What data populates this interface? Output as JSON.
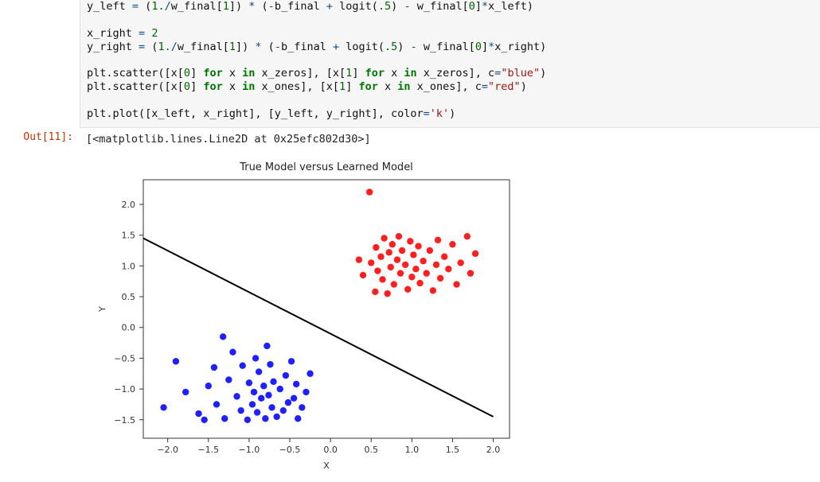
{
  "cell": {
    "out_prompt": "Out[11]:",
    "out_text": "[<matplotlib.lines.Line2D at 0x25efc802d30>]",
    "code_tokens": [
      [
        "y_left ",
        ""
      ],
      [
        "=",
        "op"
      ],
      [
        " (",
        ""
      ],
      [
        "1.",
        "num"
      ],
      [
        "/",
        "op"
      ],
      [
        "w_final[",
        ""
      ],
      [
        "1",
        "num"
      ],
      [
        "]) ",
        ""
      ],
      [
        "*",
        "op"
      ],
      [
        " (",
        ""
      ],
      [
        "-",
        "op"
      ],
      [
        "b_final ",
        ""
      ],
      [
        "+",
        "op"
      ],
      [
        " logit(",
        ""
      ],
      [
        ".5",
        "num"
      ],
      [
        ") ",
        ""
      ],
      [
        "-",
        "op"
      ],
      [
        " w_final[",
        ""
      ],
      [
        "0",
        "num"
      ],
      [
        "]",
        ""
      ],
      [
        "*",
        "op"
      ],
      [
        "x_left)\n",
        ""
      ],
      [
        "\n",
        ""
      ],
      [
        "x_right ",
        ""
      ],
      [
        "=",
        "op"
      ],
      [
        " ",
        ""
      ],
      [
        "2",
        "num"
      ],
      [
        "\n",
        ""
      ],
      [
        "y_right ",
        ""
      ],
      [
        "=",
        "op"
      ],
      [
        " (",
        ""
      ],
      [
        "1.",
        "num"
      ],
      [
        "/",
        "op"
      ],
      [
        "w_final[",
        ""
      ],
      [
        "1",
        "num"
      ],
      [
        "]) ",
        ""
      ],
      [
        "*",
        "op"
      ],
      [
        " (",
        ""
      ],
      [
        "-",
        "op"
      ],
      [
        "b_final ",
        ""
      ],
      [
        "+",
        "op"
      ],
      [
        " logit(",
        ""
      ],
      [
        ".5",
        "num"
      ],
      [
        ") ",
        ""
      ],
      [
        "-",
        "op"
      ],
      [
        " w_final[",
        ""
      ],
      [
        "0",
        "num"
      ],
      [
        "]",
        ""
      ],
      [
        "*",
        "op"
      ],
      [
        "x_right)\n",
        ""
      ],
      [
        "\n",
        ""
      ],
      [
        "plt.scatter([x[",
        ""
      ],
      [
        "0",
        "num"
      ],
      [
        "] ",
        ""
      ],
      [
        "for",
        "kw"
      ],
      [
        " x ",
        ""
      ],
      [
        "in",
        "kw"
      ],
      [
        " x_zeros], [x[",
        ""
      ],
      [
        "1",
        "num"
      ],
      [
        "] ",
        ""
      ],
      [
        "for",
        "kw"
      ],
      [
        " x ",
        ""
      ],
      [
        "in",
        "kw"
      ],
      [
        " x_zeros], c",
        ""
      ],
      [
        "=",
        "op"
      ],
      [
        "\"blue\"",
        "str"
      ],
      [
        ")\n",
        ""
      ],
      [
        "plt.scatter([x[",
        ""
      ],
      [
        "0",
        "num"
      ],
      [
        "] ",
        ""
      ],
      [
        "for",
        "kw"
      ],
      [
        " x ",
        ""
      ],
      [
        "in",
        "kw"
      ],
      [
        " x_ones], [x[",
        ""
      ],
      [
        "1",
        "num"
      ],
      [
        "] ",
        ""
      ],
      [
        "for",
        "kw"
      ],
      [
        " x ",
        ""
      ],
      [
        "in",
        "kw"
      ],
      [
        " x_ones], c",
        ""
      ],
      [
        "=",
        "op"
      ],
      [
        "\"red\"",
        "str"
      ],
      [
        ")\n",
        ""
      ],
      [
        "\n",
        ""
      ],
      [
        "plt.plot([x_left, x_right], [y_left, y_right], color",
        ""
      ],
      [
        "=",
        "op"
      ],
      [
        "'k'",
        "str"
      ],
      [
        ")",
        ""
      ]
    ]
  },
  "chart_data": {
    "type": "scatter",
    "title": "True Model versus Learned Model",
    "xlabel": "X",
    "ylabel": "Y",
    "xlim": [
      -2.3,
      2.2
    ],
    "ylim": [
      -1.8,
      2.4
    ],
    "xticks": [
      -2.0,
      -1.5,
      -1.0,
      -0.5,
      0.0,
      0.5,
      1.0,
      1.5,
      2.0
    ],
    "yticks": [
      -1.5,
      -1.0,
      -0.5,
      0.0,
      0.5,
      1.0,
      1.5,
      2.0
    ],
    "series": [
      {
        "name": "zeros",
        "color": "#1f1fff",
        "points": [
          [
            -2.05,
            -1.3
          ],
          [
            -1.9,
            -0.55
          ],
          [
            -1.78,
            -1.05
          ],
          [
            -1.62,
            -1.4
          ],
          [
            -1.55,
            -1.5
          ],
          [
            -1.5,
            -0.95
          ],
          [
            -1.43,
            -0.65
          ],
          [
            -1.4,
            -1.25
          ],
          [
            -1.32,
            -0.15
          ],
          [
            -1.3,
            -1.48
          ],
          [
            -1.25,
            -0.85
          ],
          [
            -1.2,
            -0.4
          ],
          [
            -1.15,
            -1.12
          ],
          [
            -1.1,
            -1.35
          ],
          [
            -1.08,
            -0.62
          ],
          [
            -1.02,
            -1.5
          ],
          [
            -1.0,
            -0.9
          ],
          [
            -0.96,
            -1.25
          ],
          [
            -0.94,
            -1.05
          ],
          [
            -0.92,
            -0.5
          ],
          [
            -0.9,
            -1.38
          ],
          [
            -0.88,
            -0.72
          ],
          [
            -0.85,
            -1.15
          ],
          [
            -0.82,
            -0.95
          ],
          [
            -0.8,
            -1.48
          ],
          [
            -0.78,
            -0.3
          ],
          [
            -0.76,
            -1.1
          ],
          [
            -0.74,
            -0.6
          ],
          [
            -0.72,
            -1.3
          ],
          [
            -0.7,
            -0.88
          ],
          [
            -0.66,
            -1.45
          ],
          [
            -0.62,
            -1.0
          ],
          [
            -0.58,
            -1.35
          ],
          [
            -0.55,
            -0.78
          ],
          [
            -0.52,
            -1.22
          ],
          [
            -0.48,
            -0.55
          ],
          [
            -0.45,
            -1.15
          ],
          [
            -0.42,
            -0.92
          ],
          [
            -0.4,
            -1.48
          ],
          [
            -0.35,
            -1.3
          ],
          [
            -0.3,
            -1.05
          ],
          [
            -0.25,
            -0.75
          ]
        ]
      },
      {
        "name": "ones",
        "color": "#ff1f1f",
        "points": [
          [
            0.35,
            1.1
          ],
          [
            0.4,
            0.85
          ],
          [
            0.48,
            2.2
          ],
          [
            0.5,
            1.05
          ],
          [
            0.55,
            0.58
          ],
          [
            0.56,
            1.3
          ],
          [
            0.58,
            0.92
          ],
          [
            0.62,
            1.15
          ],
          [
            0.64,
            0.78
          ],
          [
            0.66,
            1.45
          ],
          [
            0.7,
            0.55
          ],
          [
            0.72,
            1.22
          ],
          [
            0.74,
            0.98
          ],
          [
            0.76,
            1.35
          ],
          [
            0.78,
            0.7
          ],
          [
            0.82,
            1.1
          ],
          [
            0.84,
            1.48
          ],
          [
            0.86,
            0.88
          ],
          [
            0.88,
            1.25
          ],
          [
            0.92,
            1.02
          ],
          [
            0.95,
            0.62
          ],
          [
            0.98,
            1.4
          ],
          [
            1.0,
            0.82
          ],
          [
            1.02,
            1.18
          ],
          [
            1.05,
            0.95
          ],
          [
            1.08,
            1.32
          ],
          [
            1.1,
            0.72
          ],
          [
            1.14,
            1.08
          ],
          [
            1.18,
            0.88
          ],
          [
            1.22,
            1.25
          ],
          [
            1.26,
            0.6
          ],
          [
            1.3,
            1.02
          ],
          [
            1.32,
            1.42
          ],
          [
            1.35,
            0.8
          ],
          [
            1.4,
            1.15
          ],
          [
            1.45,
            0.95
          ],
          [
            1.5,
            1.35
          ],
          [
            1.55,
            0.7
          ],
          [
            1.6,
            1.05
          ],
          [
            1.68,
            1.48
          ],
          [
            1.72,
            0.88
          ],
          [
            1.78,
            1.2
          ]
        ]
      }
    ],
    "line": {
      "color": "#000000",
      "x": [
        -2.3,
        2.0
      ],
      "y": [
        1.45,
        -1.45
      ]
    }
  }
}
